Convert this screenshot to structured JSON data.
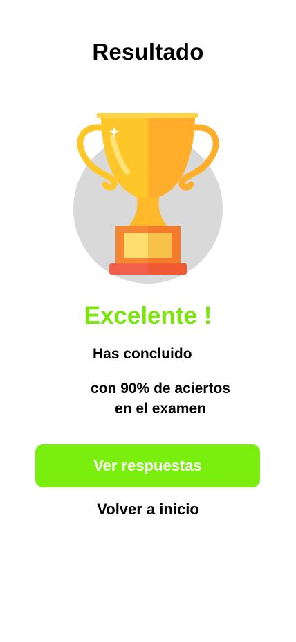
{
  "header": {
    "title": "Resultado"
  },
  "illustration": {
    "icon": "trophy-icon",
    "circle_color": "#D9D9D9",
    "cup_light_color": "#FFC629",
    "cup_shade_color": "#FFAE2B",
    "base_color": "#F58634",
    "plate_color": "#FFDE6F",
    "foot_color": "#F2604B"
  },
  "result": {
    "heading": "Excelente !",
    "heading_color": "#7AE50C",
    "line_1": "Has concluido",
    "line_2a": "con 90% de aciertos",
    "line_2b": "en el examen"
  },
  "actions": {
    "primary_label": "Ver respuestas",
    "primary_color": "#7AEE0C",
    "secondary_label": "Volver a inicio"
  }
}
